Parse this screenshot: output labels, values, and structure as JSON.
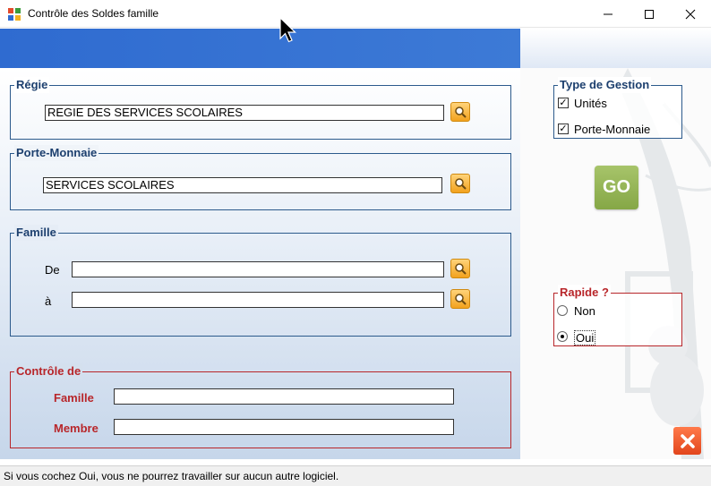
{
  "window": {
    "title": "Contrôle des Soldes famille",
    "minimize_icon": "minimize-icon",
    "maximize_icon": "maximize-icon",
    "close_icon": "close-icon"
  },
  "regie": {
    "legend": "Régie",
    "value": "REGIE DES SERVICES SCOLAIRES",
    "search_icon": "search-icon"
  },
  "porte_monnaie": {
    "legend": "Porte-Monnaie",
    "value": "SERVICES SCOLAIRES",
    "search_icon": "search-icon"
  },
  "famille": {
    "legend": "Famille",
    "from_label": "De",
    "from_value": "",
    "to_label": "à",
    "to_value": ""
  },
  "controle": {
    "legend": "Contrôle de",
    "famille_label": "Famille",
    "famille_value": "",
    "membre_label": "Membre",
    "membre_value": ""
  },
  "type_gestion": {
    "legend": "Type de Gestion",
    "options": [
      {
        "label": "Unités",
        "checked": true
      },
      {
        "label": "Porte-Monnaie",
        "checked": true
      }
    ]
  },
  "go_button": {
    "label": "GO"
  },
  "rapide": {
    "legend": "Rapide ?",
    "options": [
      {
        "label": "Non",
        "selected": false
      },
      {
        "label": "Oui",
        "selected": true
      }
    ]
  },
  "status": {
    "text": "Si vous cochez Oui, vous ne pourrez travailler sur aucun autre logiciel."
  },
  "colors": {
    "banner": "#2f6bd0",
    "blue_border": "#2c5a8c",
    "red_accent": "#b8262a",
    "go_green": "#94b556",
    "close_orange": "#e8521f"
  }
}
